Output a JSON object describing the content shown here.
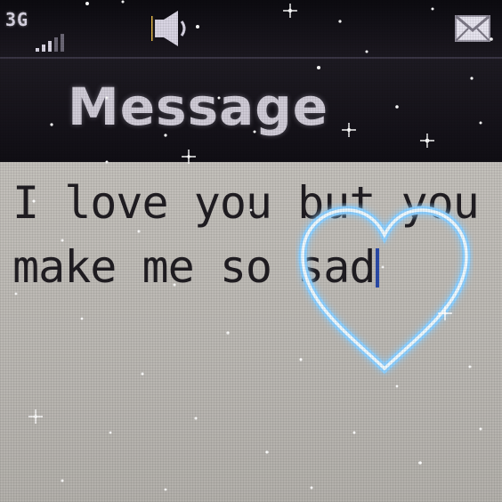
{
  "status_bar": {
    "network_type": "3G",
    "signal_icon": "signal-bars-icon",
    "sound_icon": "speaker-icon",
    "message_icon": "envelope-icon"
  },
  "header": {
    "title": "Message"
  },
  "composer": {
    "text": "I love you but you\nmake me so sad",
    "cursor": true
  },
  "decorations": {
    "heart_icon": "heart-outline-icon",
    "heart_color": "#dff3ff",
    "heart_glow": "#8fd0ff",
    "sparkle_icon": "sparkle-icon"
  },
  "colors": {
    "background": "#17141d",
    "screen_body": "#c3c0bb",
    "text": "#201d22",
    "cursor": "#2a4aa8"
  }
}
